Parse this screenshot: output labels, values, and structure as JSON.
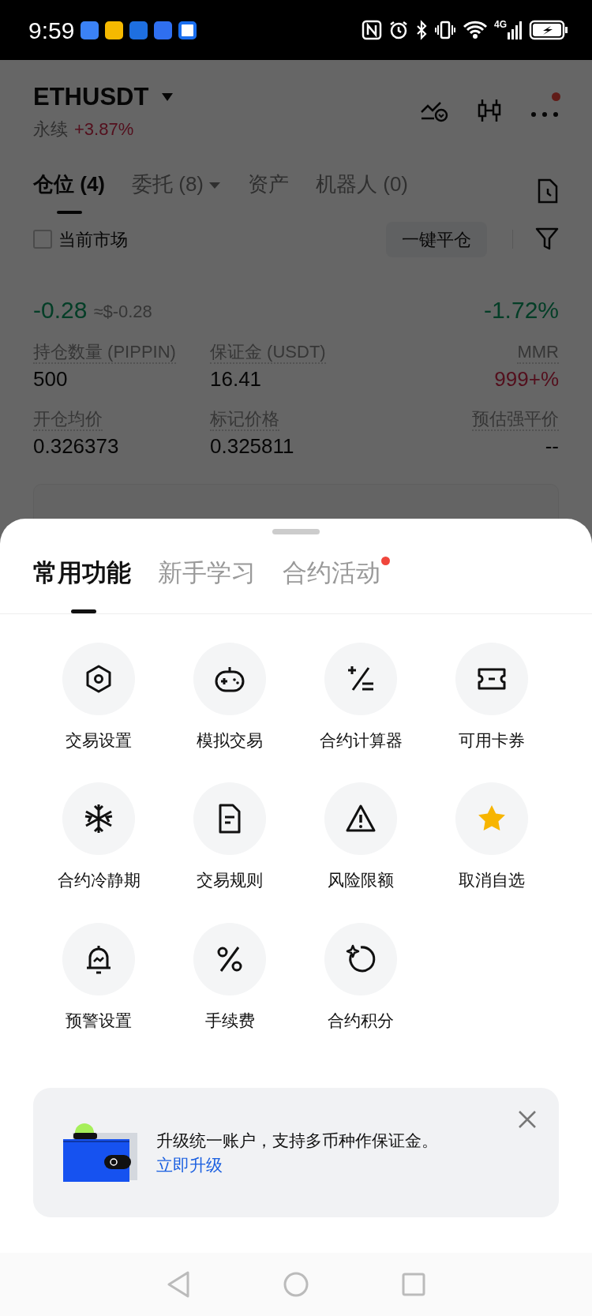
{
  "status_bar": {
    "time": "9:59",
    "network": "4G"
  },
  "header": {
    "symbol": "ETHUSDT",
    "contract_type": "永续",
    "change": "+3.87%",
    "more_badge": true
  },
  "position_tabs": [
    {
      "label": "仓位 (4)",
      "selected": true,
      "dropdown": false
    },
    {
      "label": "委托 (8)",
      "selected": false,
      "dropdown": true
    },
    {
      "label": "资产",
      "selected": false,
      "dropdown": false
    },
    {
      "label": "机器人 (0)",
      "selected": false,
      "dropdown": false
    }
  ],
  "filter": {
    "label": "当前市场",
    "checked": false
  },
  "close_all_button": "一键平仓",
  "position": {
    "pnl": "-0.28",
    "pnl_usd": "≈$-0.28",
    "roe": "-1.72%",
    "fields": [
      {
        "label": "持仓数量 (PIPPIN)",
        "value": "500",
        "highlighted": false
      },
      {
        "label": "保证金 (USDT)",
        "value": "16.41",
        "highlighted": false
      },
      {
        "label": "MMR",
        "value": "999+%",
        "highlighted": true
      },
      {
        "label": "开仓均价",
        "value": "0.326373",
        "highlighted": false
      },
      {
        "label": "标记价格",
        "value": "0.325811",
        "highlighted": false
      },
      {
        "label": "预估强平价",
        "value": "--",
        "highlighted": false
      }
    ]
  },
  "sheet": {
    "tabs": [
      {
        "label": "常用功能",
        "selected": true,
        "badge": false
      },
      {
        "label": "新手学习",
        "selected": false,
        "badge": false
      },
      {
        "label": "合约活动",
        "selected": false,
        "badge": true
      }
    ],
    "actions": [
      {
        "label": "交易设置",
        "kind": "hexagon"
      },
      {
        "label": "模拟交易",
        "kind": "gamepad"
      },
      {
        "label": "合约计算器",
        "kind": "calculator"
      },
      {
        "label": "可用卡券",
        "kind": "ticket"
      },
      {
        "label": "合约冷静期",
        "kind": "snowflake"
      },
      {
        "label": "交易规则",
        "kind": "document"
      },
      {
        "label": "风险限额",
        "kind": "warning"
      },
      {
        "label": "取消自选",
        "kind": "star"
      },
      {
        "label": "预警设置",
        "kind": "bell"
      },
      {
        "label": "手续费",
        "kind": "percent"
      },
      {
        "label": "合约积分",
        "kind": "points"
      }
    ],
    "banner": {
      "text": "升级统一账户，支持多币种作保证金。",
      "link": "立即升级",
      "closable": true
    }
  }
}
